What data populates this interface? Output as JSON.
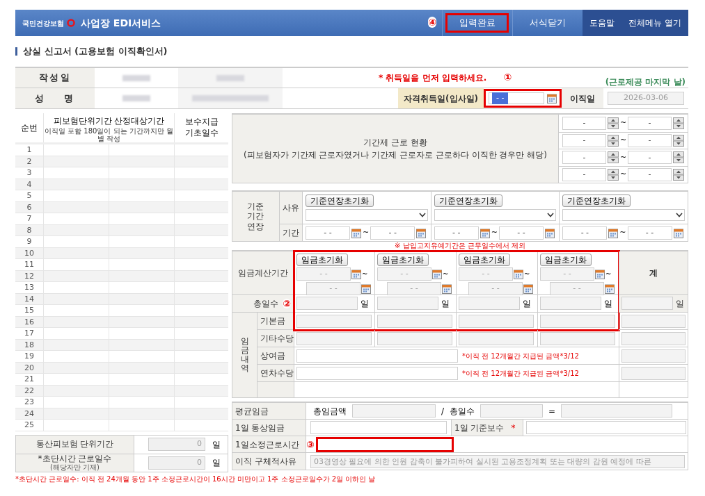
{
  "header": {
    "logo_text": "국민건강보험",
    "service_name": "사업장 EDI서비스",
    "menu": [
      {
        "label": "입력완료",
        "highlighted": true,
        "marker": "④"
      },
      {
        "label": "서식닫기",
        "highlighted": false
      },
      {
        "label": "도움말",
        "highlighted": false
      },
      {
        "label": "전체메뉴 열기",
        "highlighted": false
      }
    ]
  },
  "page_title": "상실 신고서 (고용보험 이직확인서)",
  "info": {
    "row_labels": [
      "작성일",
      "성 명"
    ],
    "notice": "* 취득일을 먼저 입력하세요.",
    "notice_marker": "①",
    "hint": "(근로제공 마지막 날)",
    "acquire": {
      "label": "자격취득일(입사일)",
      "value": "- -",
      "highlighted": true
    },
    "leave": {
      "label": "이직일",
      "value": "2026-03-06"
    }
  },
  "period_table": {
    "columns": [
      "순번",
      "피보험단위기간 산정대상기간",
      "보수지급 기초일수"
    ],
    "column_note": "이직일 포함 180일이 되는 기간까지만 월별 작성",
    "rows": [
      "1",
      "2",
      "3",
      "4",
      "5",
      "6",
      "7",
      "8",
      "9",
      "10",
      "11",
      "12",
      "13",
      "14",
      "15",
      "16",
      "17",
      "18",
      "19",
      "20",
      "21",
      "22",
      "23",
      "24",
      "25"
    ]
  },
  "summary": [
    {
      "label": "통산피보험 단위기간",
      "value": "0",
      "unit": "일"
    },
    {
      "label": "*초단시간 근로일수",
      "sublabel": "(해당자만 기재)",
      "value": "0",
      "unit": "일"
    }
  ],
  "footnote": "*초단시간 근로일수: 이직 전 24개월 동안 1주 소정근로시간이 16시간 미만이고 1주 소정근로일수가 2일 이하인 날",
  "fixed_term": {
    "title": "기간제 근로 현황",
    "subtitle": "(피보험자가 기간제 근로자였거나 기간제 근로자로 근로하다 이직한 경우만 해당)",
    "separator": "~",
    "periods": [
      {
        "from": "-",
        "to": "-"
      },
      {
        "from": "-",
        "to": "-"
      },
      {
        "from": "-",
        "to": "-"
      },
      {
        "from": "-",
        "to": "-"
      }
    ]
  },
  "extension": {
    "label": "기준 기간 연장",
    "reason_label": "사유",
    "period_label": "기간",
    "separator": "~",
    "columns": [
      {
        "reset": "기준연장초기화",
        "from": "- -",
        "to": "- -"
      },
      {
        "reset": "기준연장초기화",
        "from": "- -",
        "to": "- -"
      },
      {
        "reset": "기준연장초기화",
        "from": "- -",
        "to": "- -"
      }
    ],
    "note": "※ 납입고지유예기간은 근무일수에서 제외"
  },
  "wages": {
    "period_label": "임금계산기간",
    "highlighted": true,
    "marker": "②",
    "total_label": "계",
    "days_label": "총일수",
    "total_unit": "일",
    "separator": "~",
    "columns": [
      {
        "reset": "임금초기화",
        "from": "- -",
        "to": "- -",
        "unit": "일"
      },
      {
        "reset": "임금초기화",
        "from": "- -",
        "to": "- -",
        "unit": "일"
      },
      {
        "reset": "임금초기화",
        "from": "- -",
        "to": "- -",
        "unit": "일"
      },
      {
        "reset": "임금초기화",
        "from": "- -",
        "to": "- -",
        "unit": "일"
      }
    ],
    "breakdown_label": "임금내역",
    "items": [
      {
        "label": "기본금",
        "kind": "split"
      },
      {
        "label": "기타수당",
        "kind": "split"
      },
      {
        "label": "상여금",
        "kind": "single",
        "note": "*이직 전 12개월간 지급된 금액*3/12"
      },
      {
        "label": "연차수당",
        "kind": "single",
        "note": "*이직 전 12개월간 지급된 금액*3/12"
      }
    ]
  },
  "average": {
    "label": "평균임금",
    "total_label": "총임금액",
    "slash": "/",
    "days_label": "총일수",
    "equals": "=",
    "daily_wage_label": "1일 통상임금",
    "base_pay_label": "1일 기준보수",
    "required_mark": "*",
    "hours_label": "1일소정근로시간",
    "hours_highlighted": true,
    "hours_marker": "③",
    "reason_label": "이직 구체적사유",
    "reason_value": "03경영상 필요에 의한 인원 감축이 불가피하여 실시된 고용조정계획 또는 대량의 감원 예정에 따른"
  }
}
